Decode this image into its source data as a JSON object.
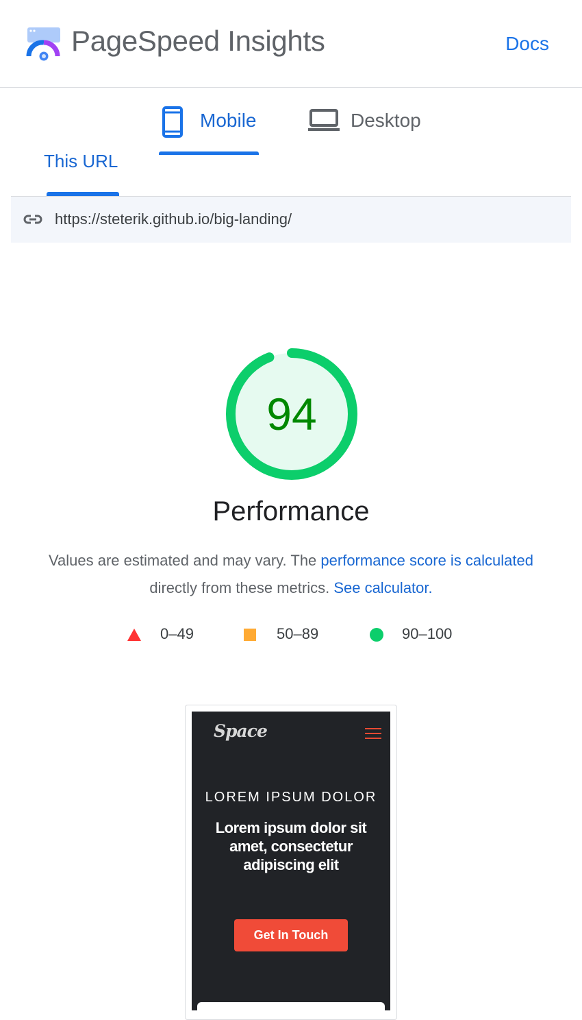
{
  "header": {
    "title": "PageSpeed Insights",
    "docs_label": "Docs",
    "logo_icon": "pagespeed-logo-icon"
  },
  "device_tabs": {
    "mobile_label": "Mobile",
    "desktop_label": "Desktop",
    "selected": "Mobile"
  },
  "url_tab": {
    "label": "This URL"
  },
  "url_bar": {
    "icon": "link-icon",
    "url": "https://steterik.github.io/big-landing/"
  },
  "performance": {
    "score": "94",
    "score_fraction": 0.94,
    "title": "Performance",
    "desc_text_1": "Values are estimated and may vary. The ",
    "desc_link_1": "performance score is calculated",
    "desc_text_2": "directly from these metrics. ",
    "desc_link_2": "See calculator."
  },
  "legend": [
    {
      "range": "0–49",
      "shape": "triangle",
      "color": "#ff3333"
    },
    {
      "range": "50–89",
      "shape": "square",
      "color": "#ffaa33"
    },
    {
      "range": "90–100",
      "shape": "circle",
      "color": "#0cce6b"
    }
  ],
  "screenshot": {
    "brand": "Space",
    "hero_subtitle": "LOREM IPSUM DOLOR",
    "hero_title": "Lorem ipsum dolor sit amet, consectetur adipiscing elit",
    "cta_label": "Get In Touch"
  },
  "colors": {
    "accent": "#1a73e8",
    "pass": "#0cce6b",
    "score_text": "#008800"
  }
}
